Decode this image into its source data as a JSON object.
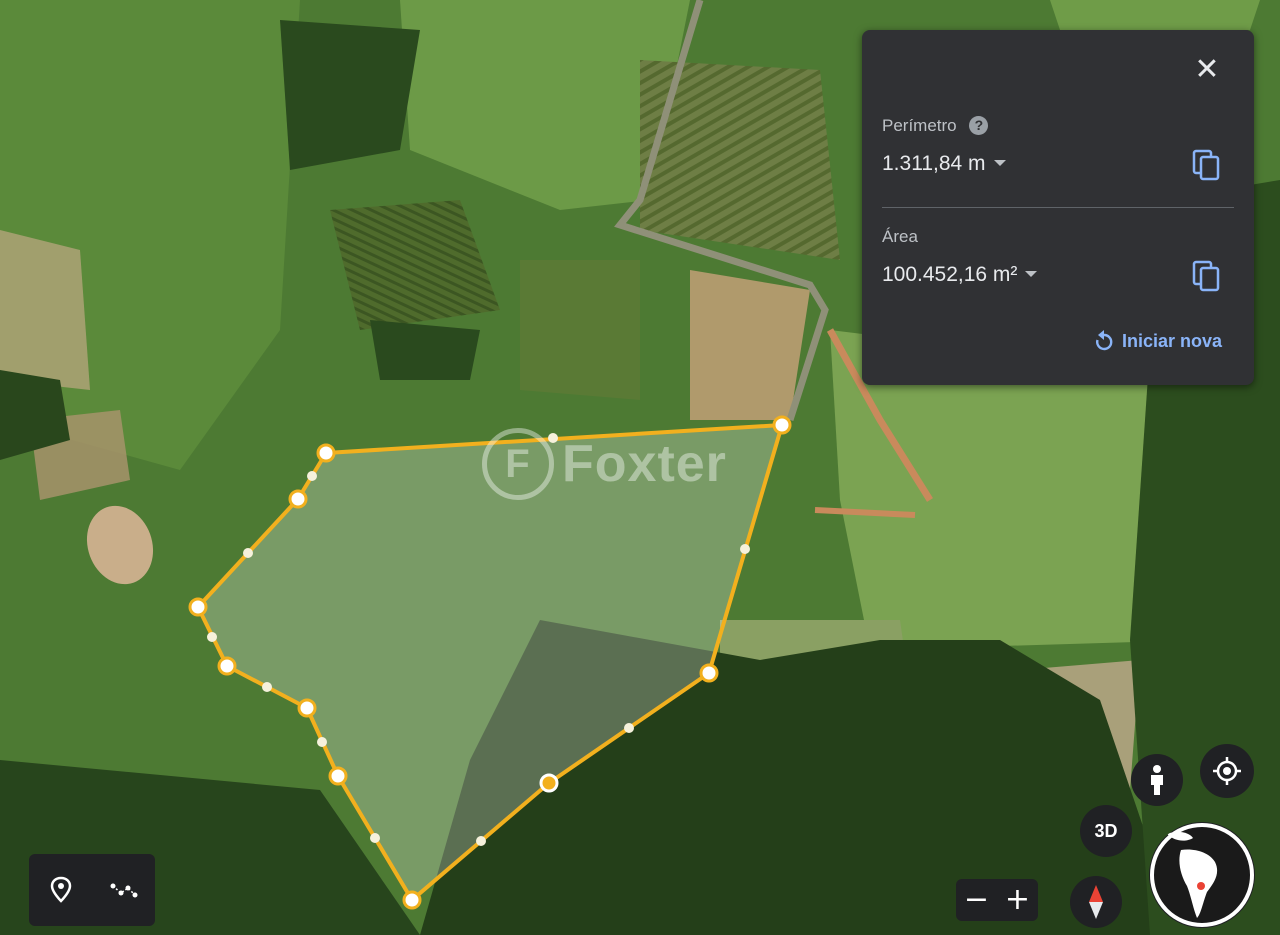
{
  "measure": {
    "perimeter_label": "Perímetro",
    "perimeter_value": "1.311,84 m",
    "area_label": "Área",
    "area_value": "100.452,16 m²",
    "restart_label": "Iniciar nova",
    "help_glyph": "?"
  },
  "watermark": {
    "text": "Foxter",
    "logo_glyph": "F"
  },
  "controls": {
    "three_d_label": "3D",
    "zoom_out": "−",
    "zoom_in": "+"
  },
  "colors": {
    "accent_blue": "#8ab4f8",
    "measure_line": "#f2b01e",
    "panel_bg": "#303134"
  }
}
